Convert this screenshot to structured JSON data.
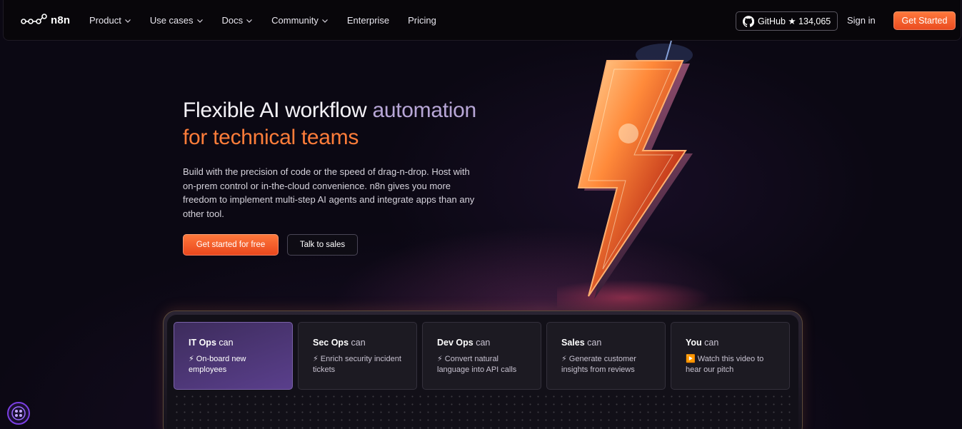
{
  "nav": {
    "logo_text": "n8n",
    "links": [
      {
        "label": "Product",
        "dropdown": true
      },
      {
        "label": "Use cases",
        "dropdown": true
      },
      {
        "label": "Docs",
        "dropdown": true
      },
      {
        "label": "Community",
        "dropdown": true
      },
      {
        "label": "Enterprise",
        "dropdown": false
      },
      {
        "label": "Pricing",
        "dropdown": false
      }
    ],
    "github_label": "GitHub ★ 134,065",
    "signin_label": "Sign in",
    "get_started_label": "Get Started"
  },
  "hero": {
    "title_part1": "Flexible AI workflow ",
    "title_part2": "automation",
    "title_line2": "for technical teams",
    "description": "Build with the precision of code or the speed of drag-n-drop. Host with on-prem control or in-the-cloud convenience. n8n gives you more freedom to implement multi-step AI agents and integrate apps than any other tool.",
    "primary_cta": "Get started for free",
    "secondary_cta": "Talk to sales"
  },
  "roles": [
    {
      "role": "IT Ops",
      "can": " can",
      "icon": "⚡",
      "text": "On-board new employees",
      "active": true
    },
    {
      "role": "Sec Ops",
      "can": " can",
      "icon": "⚡",
      "text": "Enrich security incident tickets",
      "active": false
    },
    {
      "role": "Dev Ops",
      "can": " can",
      "icon": "⚡",
      "text": "Convert natural language into API calls",
      "active": false
    },
    {
      "role": "Sales",
      "can": " can",
      "icon": "⚡",
      "text": "Generate customer insights from reviews",
      "active": false
    },
    {
      "role": "You",
      "can": " can",
      "icon": "▶️",
      "text": "Watch this video to hear our pitch",
      "active": false
    }
  ],
  "colors": {
    "accent_orange": "#ff7d3a",
    "lilac": "#b7a6d6",
    "active_card": "#5a3f8c",
    "background": "#0b0813"
  }
}
